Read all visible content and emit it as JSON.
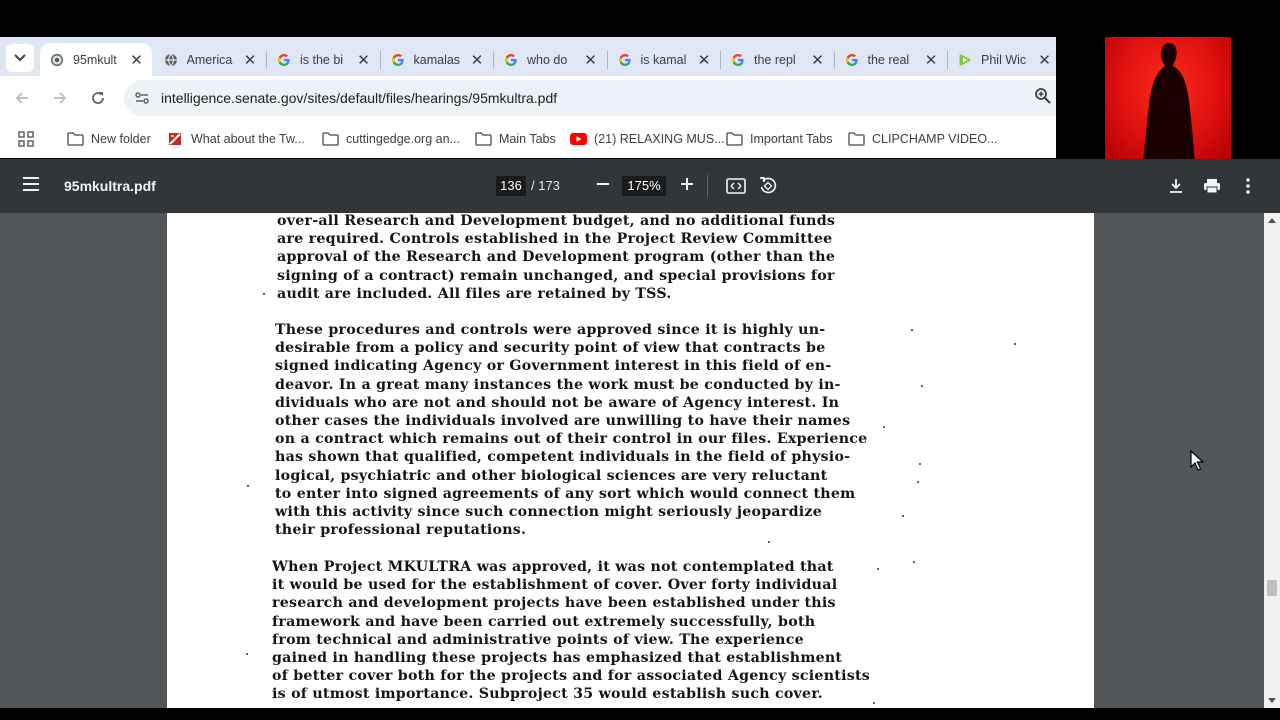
{
  "browser": {
    "tabs": [
      {
        "title": "95mkult",
        "favicon": "senate-seal-icon",
        "active": true
      },
      {
        "title": "America",
        "favicon": "globe-icon"
      },
      {
        "title": "is the bi",
        "favicon": "google-icon"
      },
      {
        "title": "kamalas",
        "favicon": "google-icon"
      },
      {
        "title": "who do",
        "favicon": "google-icon"
      },
      {
        "title": "is kamal",
        "favicon": "google-icon"
      },
      {
        "title": "the repl",
        "favicon": "google-icon"
      },
      {
        "title": "the real",
        "favicon": "google-icon"
      },
      {
        "title": "Phil Wic",
        "favicon": "rumble-icon"
      }
    ],
    "url": "intelligence.senate.gov/sites/default/files/hearings/95mkultra.pdf",
    "bookmarks": [
      {
        "label": "New folder",
        "icon": "folder-icon"
      },
      {
        "label": "What about the Tw...",
        "icon": "bookmark-favicon"
      },
      {
        "label": "cuttingedge.org an...",
        "icon": "folder-icon"
      },
      {
        "label": "Main Tabs",
        "icon": "folder-icon"
      },
      {
        "label": "(21) RELAXING MUS...",
        "icon": "youtube-icon"
      },
      {
        "label": "Important Tabs",
        "icon": "folder-icon"
      },
      {
        "label": "CLIPCHAMP VIDEO...",
        "icon": "folder-icon"
      }
    ]
  },
  "pdf": {
    "filename": "95mkultra.pdf",
    "current_page": "136",
    "total_pages": "/ 173",
    "zoom": "175%",
    "paragraphs": [
      [
        "over-all Research and Development budget, and no additional funds",
        "are required.  Controls established in the Project Review Committee",
        "approval of the Research and Development program (other than the",
        "signing of a contract) remain unchanged, and special provisions for",
        "audit are included.  All files are retained by TSS."
      ],
      [
        "These procedures and controls were approved since it is highly un-",
        "desirable from a policy and security point of view that contracts be",
        "signed indicating Agency or Government interest in this field of en-",
        "deavor.  In a great many instances the work must be conducted by in-",
        "dividuals who are not and should not be aware of Agency interest.  In",
        "other cases the individuals involved are unwilling to have their names",
        "on a contract which remains out of their control in our files.  Experience",
        "has shown that qualified, competent individuals in the field of physio-",
        "logical, psychiatric and other biological sciences are very reluctant",
        "to enter into signed agreements of any sort which would connect them",
        "with this activity since such connection might seriously jeopardize",
        "their professional reputations."
      ],
      [
        "When Project MKULTRA was approved, it was not contemplated that",
        "it would be used for the establishment of cover.  Over forty individual",
        "research and development projects have been established under this",
        "framework and have been carried out extremely successfully, both",
        "from technical and administrative points of view.  The experience",
        "gained in handling these projects has emphasized that establishment",
        "of better cover both for the projects and for associated Agency scientists",
        "is of utmost importance.  Subproject 35 would establish such cover."
      ]
    ]
  },
  "colors": {
    "tabstrip": "#dfe7f4",
    "pdf_toolbar": "#323639",
    "pdf_background": "#525659",
    "webcam": "#e01010"
  }
}
